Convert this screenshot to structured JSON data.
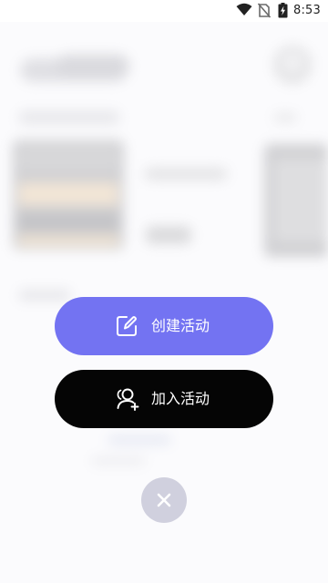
{
  "status_bar": {
    "time": "8:53",
    "icons": [
      "wifi-icon",
      "no-sim-icon",
      "battery-charging-icon"
    ]
  },
  "actions": {
    "create": {
      "label": "创建活动",
      "icon": "edit-icon",
      "color": "#7373f2"
    },
    "join": {
      "label": "加入活动",
      "icon": "add-user-icon",
      "color": "#050505"
    },
    "close": {
      "icon": "close-icon",
      "color": "#d0d0de"
    }
  }
}
